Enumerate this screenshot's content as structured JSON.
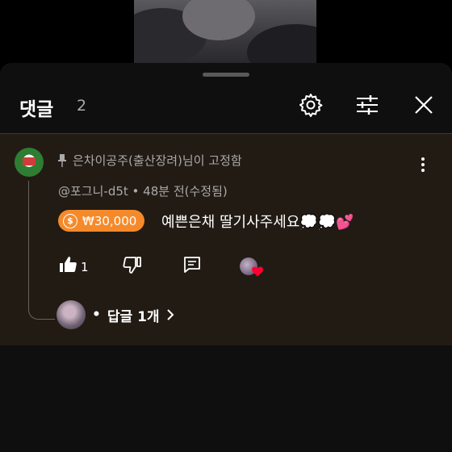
{
  "header": {
    "title": "댓글",
    "count": "2"
  },
  "pinned_comment": {
    "pinned_label": "은차이공주(출산장려)님이 고정함",
    "author": "@포그니-d5t",
    "time": "48분 전(수정됨)",
    "superchat_amount": "₩30,000",
    "text": "예쁜은채 딸기사주세요💭💭💕",
    "like_count": "1"
  },
  "replies": {
    "label": "답글 1개"
  },
  "colors": {
    "sheet": "#0f0f0f",
    "comment_bg": "#221b14",
    "superchat": "#f58a2b",
    "heart": "#ff0033"
  },
  "icons": [
    "settings-icon",
    "filter-icon",
    "close-icon",
    "pin-icon",
    "more-vert-icon",
    "like-icon",
    "dislike-icon",
    "reply-icon",
    "creator-heart-icon",
    "chevron-right-icon"
  ]
}
